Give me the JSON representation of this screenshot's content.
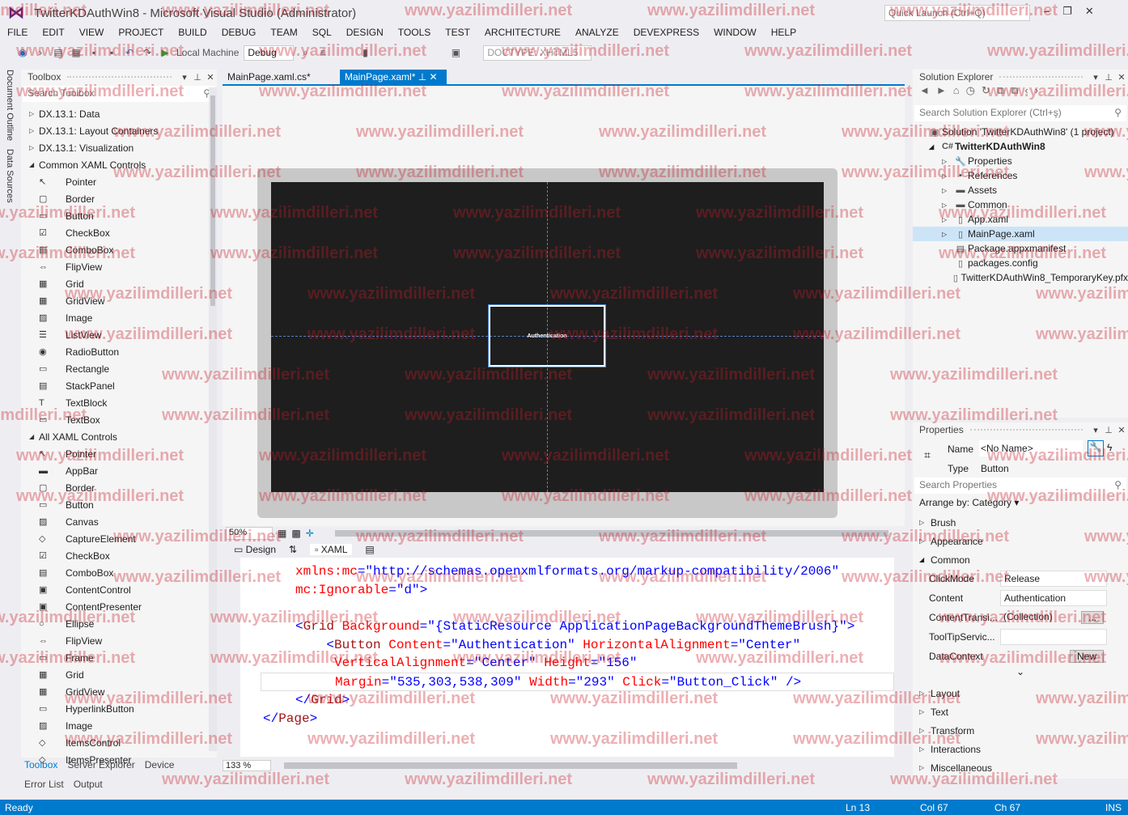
{
  "window": {
    "title": "TwitterKDAuthWin8 - Microsoft Visual Studio (Administrator)",
    "quick_launch": "Quick Launch (Ctrl+Q)"
  },
  "menu": [
    "FILE",
    "EDIT",
    "VIEW",
    "PROJECT",
    "BUILD",
    "DEBUG",
    "TEAM",
    "SQL",
    "DESIGN",
    "TOOLS",
    "TEST",
    "ARCHITECTURE",
    "ANALYZE",
    "DEVEXPRESS",
    "WINDOW",
    "HELP"
  ],
  "toolbar": {
    "target": "Local Machine",
    "config": "Debug",
    "doctype": "DOCTYPE: XHTML5"
  },
  "side_tabs": [
    "Document Outline",
    "Data Sources"
  ],
  "toolbox": {
    "title": "Toolbox",
    "search_placeholder": "Search Toolbox",
    "items": [
      {
        "type": "cat",
        "label": "DX.13.1: Data",
        "open": false
      },
      {
        "type": "cat",
        "label": "DX.13.1: Layout Containers",
        "open": false
      },
      {
        "type": "cat",
        "label": "DX.13.1: Visualization",
        "open": false
      },
      {
        "type": "cat",
        "label": "Common XAML Controls",
        "open": true
      },
      {
        "type": "ctl",
        "label": "Pointer"
      },
      {
        "type": "ctl",
        "label": "Border"
      },
      {
        "type": "ctl",
        "label": "Button"
      },
      {
        "type": "ctl",
        "label": "CheckBox"
      },
      {
        "type": "ctl",
        "label": "ComboBox"
      },
      {
        "type": "ctl",
        "label": "FlipView"
      },
      {
        "type": "ctl",
        "label": "Grid"
      },
      {
        "type": "ctl",
        "label": "GridView"
      },
      {
        "type": "ctl",
        "label": "Image"
      },
      {
        "type": "ctl",
        "label": "ListView"
      },
      {
        "type": "ctl",
        "label": "RadioButton"
      },
      {
        "type": "ctl",
        "label": "Rectangle"
      },
      {
        "type": "ctl",
        "label": "StackPanel"
      },
      {
        "type": "ctl",
        "label": "TextBlock"
      },
      {
        "type": "ctl",
        "label": "TextBox"
      },
      {
        "type": "cat",
        "label": "All XAML Controls",
        "open": true
      },
      {
        "type": "ctl",
        "label": "Pointer"
      },
      {
        "type": "ctl",
        "label": "AppBar"
      },
      {
        "type": "ctl",
        "label": "Border"
      },
      {
        "type": "ctl",
        "label": "Button"
      },
      {
        "type": "ctl",
        "label": "Canvas"
      },
      {
        "type": "ctl",
        "label": "CaptureElement"
      },
      {
        "type": "ctl",
        "label": "CheckBox"
      },
      {
        "type": "ctl",
        "label": "ComboBox"
      },
      {
        "type": "ctl",
        "label": "ContentControl"
      },
      {
        "type": "ctl",
        "label": "ContentPresenter"
      },
      {
        "type": "ctl",
        "label": "Ellipse"
      },
      {
        "type": "ctl",
        "label": "FlipView"
      },
      {
        "type": "ctl",
        "label": "Frame"
      },
      {
        "type": "ctl",
        "label": "Grid"
      },
      {
        "type": "ctl",
        "label": "GridView"
      },
      {
        "type": "ctl",
        "label": "HyperlinkButton"
      },
      {
        "type": "ctl",
        "label": "Image"
      },
      {
        "type": "ctl",
        "label": "ItemsControl"
      },
      {
        "type": "ctl",
        "label": "ItemsPresenter"
      }
    ],
    "bottom_tabs": [
      "Toolbox",
      "Server Explorer",
      "Device"
    ]
  },
  "bottom_panels": [
    "Error List",
    "Output"
  ],
  "doc_tabs": [
    {
      "label": "MainPage.xaml.cs*",
      "active": false
    },
    {
      "label": "MainPage.xaml*",
      "active": true
    }
  ],
  "designer": {
    "button_content": "Authentication",
    "zoom": "50%",
    "tab_design": "Design",
    "tab_xaml": "XAML"
  },
  "code": {
    "zoom": "133 %",
    "lines": [
      [
        [
          "at",
          "xmlns:mc"
        ],
        [
          "pu",
          "=\""
        ],
        [
          "av",
          "http://schemas.openxmlformats.org/markup-compatibility/2006"
        ],
        [
          "pu",
          "\""
        ]
      ],
      [
        [
          "at",
          "mc:Ignorable"
        ],
        [
          "pu",
          "=\""
        ],
        [
          "av",
          "d"
        ],
        [
          "pu",
          "\">"
        ]
      ],
      [],
      [
        [
          "pu",
          "<"
        ],
        [
          "tag",
          "Grid"
        ],
        [
          "at",
          " Background"
        ],
        [
          "pu",
          "=\""
        ],
        [
          "av",
          "{StaticResource ApplicationPageBackgroundThemeBrush}"
        ],
        [
          "pu",
          "\">"
        ]
      ],
      [
        [
          "pu",
          "    <"
        ],
        [
          "tag",
          "Button"
        ],
        [
          "at",
          " Content"
        ],
        [
          "pu",
          "=\""
        ],
        [
          "av",
          "Authentication"
        ],
        [
          "pu",
          "\""
        ],
        [
          "at",
          " HorizontalAlignment"
        ],
        [
          "pu",
          "=\""
        ],
        [
          "av",
          "Center"
        ],
        [
          "pu",
          "\""
        ]
      ],
      [
        [
          "at",
          "     VerticalAlignment"
        ],
        [
          "pu",
          "=\""
        ],
        [
          "av",
          "Center"
        ],
        [
          "pu",
          "\""
        ],
        [
          "at",
          " Height"
        ],
        [
          "pu",
          "=\""
        ],
        [
          "av",
          "156"
        ],
        [
          "pu",
          "\""
        ]
      ],
      [
        [
          "at",
          "     Margin"
        ],
        [
          "pu",
          "=\""
        ],
        [
          "av",
          "535,303,538,309"
        ],
        [
          "pu",
          "\""
        ],
        [
          "at",
          " Width"
        ],
        [
          "pu",
          "=\""
        ],
        [
          "av",
          "293"
        ],
        [
          "pu",
          "\""
        ],
        [
          "at",
          " Click"
        ],
        [
          "pu",
          "=\""
        ],
        [
          "av",
          "Button_Click"
        ],
        [
          "pu",
          "\" />"
        ]
      ],
      [
        [
          "pu",
          "</"
        ],
        [
          "tag",
          "Grid"
        ],
        [
          "pu",
          ">"
        ]
      ],
      [
        [
          "pu",
          "</"
        ],
        [
          "tag",
          "Page"
        ],
        [
          "pu",
          ">"
        ]
      ]
    ]
  },
  "solution": {
    "title": "Solution Explorer",
    "search_placeholder": "Search Solution Explorer (Ctrl+ş)",
    "items": [
      {
        "label": "Solution 'TwitterKDAuthWin8' (1 project)",
        "icon": "solution-icon",
        "indent": 0
      },
      {
        "label": "TwitterKDAuthWin8",
        "icon": "csharp-project-icon",
        "indent": 1,
        "bold": true
      },
      {
        "label": "Properties",
        "icon": "wrench-icon",
        "indent": 2
      },
      {
        "label": "References",
        "icon": "references-icon",
        "indent": 2
      },
      {
        "label": "Assets",
        "icon": "folder-icon",
        "indent": 2
      },
      {
        "label": "Common",
        "icon": "folder-icon",
        "indent": 2
      },
      {
        "label": "App.xaml",
        "icon": "xaml-file-icon",
        "indent": 2
      },
      {
        "label": "MainPage.xaml",
        "icon": "xaml-file-icon",
        "indent": 2,
        "selected": true
      },
      {
        "label": "Package.appxmanifest",
        "icon": "manifest-icon",
        "indent": 2
      },
      {
        "label": "packages.config",
        "icon": "config-icon",
        "indent": 2
      },
      {
        "label": "TwitterKDAuthWin8_TemporaryKey.pfx",
        "icon": "key-icon",
        "indent": 2
      }
    ]
  },
  "properties": {
    "title": "Properties",
    "name_label": "Name",
    "name_value": "<No Name>",
    "type_label": "Type",
    "type_value": "Button",
    "search_placeholder": "Search Properties",
    "arrange": "Arrange by: Category",
    "categories_before": [
      "Brush",
      "Appearance"
    ],
    "common": "Common",
    "props": [
      {
        "name": "ClickMode",
        "value": "Release"
      },
      {
        "name": "Content",
        "value": "Authentication"
      },
      {
        "name": "ContentTransi...",
        "value": "(Collection)",
        "button": "..."
      },
      {
        "name": "ToolTipServic...",
        "value": ""
      },
      {
        "name": "DataContext",
        "value": "",
        "button": "New"
      }
    ],
    "categories_after": [
      "Layout",
      "Text",
      "Transform",
      "Interactions",
      "Miscellaneous"
    ]
  },
  "status": {
    "state": "Ready",
    "ln": "Ln 13",
    "col": "Col 67",
    "ch": "Ch 67",
    "mode": "INS"
  },
  "watermark": "www.yazilimdilleri.net",
  "colors": {
    "accent": "#007acc",
    "vs_purple": "#68217a"
  }
}
